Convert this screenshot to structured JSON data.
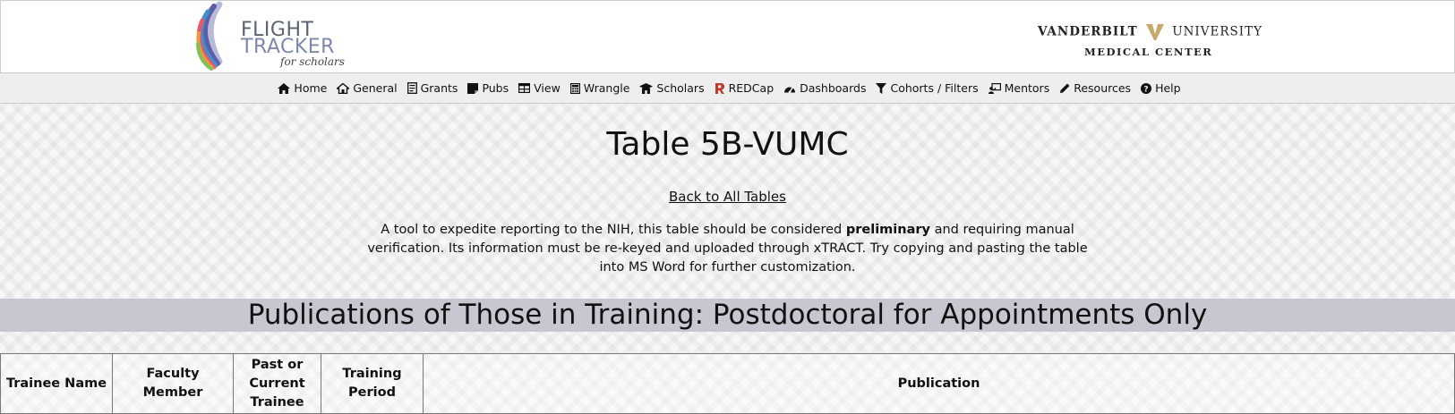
{
  "header": {
    "logo_left": {
      "line1": "FLIGHT",
      "line2": "TRACKER",
      "line3": "for scholars",
      "colors": [
        "#5a5fa8",
        "#3f8fd0",
        "#e45a6b",
        "#f29a3b",
        "#7cc15a",
        "#b9b9d9"
      ]
    },
    "logo_right": {
      "line1_a": "VANDERBILT",
      "line1_b": "UNIVERSITY",
      "line2": "MEDICAL CENTER",
      "accent": "#c7a96b"
    }
  },
  "nav": {
    "items": [
      {
        "label": "Home",
        "icon": "home-icon"
      },
      {
        "label": "General",
        "icon": "general-icon"
      },
      {
        "label": "Grants",
        "icon": "grants-icon"
      },
      {
        "label": "Pubs",
        "icon": "pubs-icon"
      },
      {
        "label": "View",
        "icon": "view-icon"
      },
      {
        "label": "Wrangle",
        "icon": "wrangle-icon"
      },
      {
        "label": "Scholars",
        "icon": "scholars-icon"
      },
      {
        "label": "REDCap",
        "icon": "redcap-icon"
      },
      {
        "label": "Dashboards",
        "icon": "dashboards-icon"
      },
      {
        "label": "Cohorts / Filters",
        "icon": "filter-icon"
      },
      {
        "label": "Mentors",
        "icon": "mentors-icon"
      },
      {
        "label": "Resources",
        "icon": "resources-icon"
      },
      {
        "label": "Help",
        "icon": "help-icon"
      }
    ]
  },
  "main": {
    "title": "Table 5B-VUMC",
    "back_link": "Back to All Tables",
    "intro": {
      "before": "A tool to expedite reporting to the NIH, this table should be considered",
      "bold": "preliminary",
      "after": "and requiring manual verification. Its information must be re-keyed and uploaded through xTRACT. Try copying and pasting the table into MS Word for further customization."
    },
    "section_title": "Publications of Those in Training: Postdoctoral for Appointments Only",
    "table": {
      "headers": [
        "Trainee Name",
        "Faculty Member",
        "Past or Current Trainee",
        "Training Period",
        "Publication"
      ]
    }
  },
  "colors": {
    "nav_bg": "#eeeeee",
    "section_band": "#c6c7d1",
    "redcap_icon": "#c0392b"
  }
}
